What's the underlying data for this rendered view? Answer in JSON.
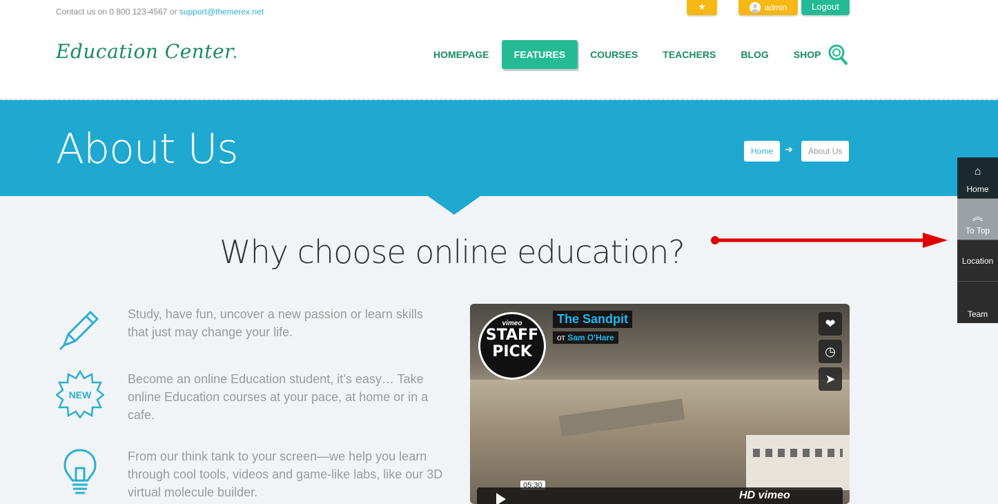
{
  "topbar": {
    "contact_prefix": "Contact us on 0 800 123-4567 or ",
    "contact_email": "support@themerex.net",
    "favorite_icon": "star-icon",
    "admin_label": "admin",
    "logout_label": "Logout"
  },
  "logo": {
    "text": "Education Center",
    "dot": "."
  },
  "nav": {
    "items": [
      "HOMEPAGE",
      "FEATURES",
      "COURSES",
      "TEACHERS",
      "BLOG",
      "SHOP"
    ],
    "active": "FEATURES"
  },
  "banner": {
    "title": "About Us",
    "breadcrumb_home": "Home",
    "breadcrumb_current": "About Us"
  },
  "section": {
    "title": "Why choose online education?"
  },
  "features": [
    {
      "icon": "pencil-icon",
      "text": "Study, have fun, uncover a new passion or learn skills that just may change your life."
    },
    {
      "icon": "new-badge-icon",
      "badge": "NEW",
      "text": "Become an online Education student, it’s easy… Take online Education courses at your pace, at home or in a cafe."
    },
    {
      "icon": "lightbulb-icon",
      "text": "From our think tank to your screen—we help you learn through cool tools, videos and game-like labs, like our 3D virtual molecule builder."
    }
  ],
  "video": {
    "badge_top": "vimeo",
    "badge_line1": "STAFF",
    "badge_line2": "PICK",
    "title": "The Sandpit",
    "by_prefix": "от ",
    "author": "Sam O'Hare",
    "duration": "05:30",
    "footer_logo": "HD vimeo"
  },
  "sidebar": {
    "items": [
      "Home",
      "To Top",
      "Location",
      "Team"
    ]
  },
  "colors": {
    "accent_green": "#24bb94",
    "banner_blue": "#1fa8d0",
    "yellow": "#f7b714",
    "annotation_red": "#e00000"
  }
}
